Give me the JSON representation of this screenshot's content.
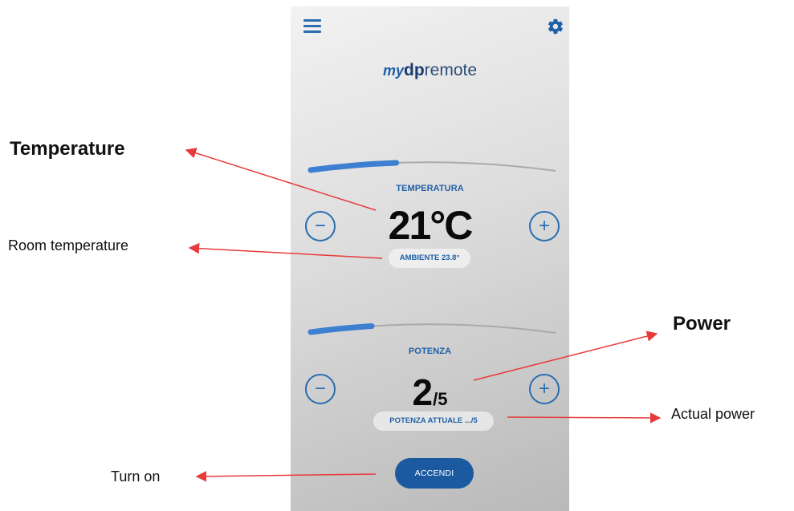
{
  "app": {
    "logo": {
      "my": "my",
      "dp": "dp",
      "remote": "remote"
    },
    "temperature": {
      "label": "TEMPERATURA",
      "value": "21°C",
      "room": "AMBIENTE 23.8°",
      "minus": "−",
      "plus": "+",
      "level": 0.35
    },
    "power": {
      "label": "POTENZA",
      "value": "2",
      "max": "/5",
      "actual": "POTENZA ATTUALE .../5",
      "minus": "−",
      "plus": "+",
      "level": 0.25
    },
    "turn_on_label": "ACCENDI"
  },
  "annotations": {
    "temperature": "Temperature",
    "room_temperature": "Room temperature",
    "power": "Power",
    "actual_power": "Actual power",
    "turn_on": "Turn on"
  },
  "colors": {
    "accent": "#2a6db0",
    "button": "#1b5aa0",
    "arrow": "#e83a3a",
    "track": "#aaaaaa"
  },
  "icons": {
    "menu": "hamburger-menu-icon",
    "settings": "gear-icon"
  }
}
